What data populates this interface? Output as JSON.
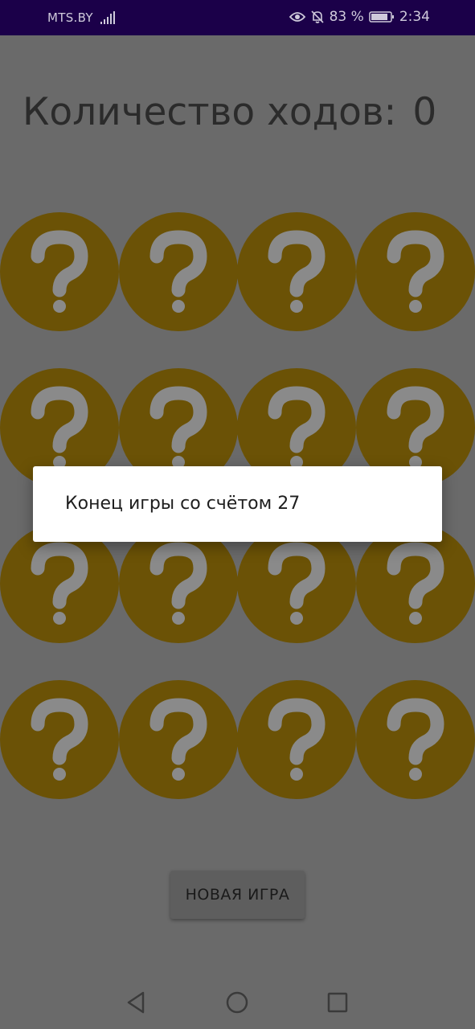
{
  "status_bar": {
    "carrier": "MTS.BY",
    "battery_percent": "83 %",
    "time": "2:34",
    "icons": [
      "signal-icon",
      "eye-icon",
      "notifications-off-icon",
      "battery-icon"
    ]
  },
  "game": {
    "moves_label": "Количество ходов:",
    "moves_count": "0",
    "cards": [
      {
        "symbol": "?"
      },
      {
        "symbol": "?"
      },
      {
        "symbol": "?"
      },
      {
        "symbol": "?"
      },
      {
        "symbol": "?"
      },
      {
        "symbol": "?"
      },
      {
        "symbol": "?"
      },
      {
        "symbol": "?"
      },
      {
        "symbol": "?"
      },
      {
        "symbol": "?"
      },
      {
        "symbol": "?"
      },
      {
        "symbol": "?"
      },
      {
        "symbol": "?"
      },
      {
        "symbol": "?"
      },
      {
        "symbol": "?"
      },
      {
        "symbol": "?"
      }
    ],
    "new_game_label": "НОВАЯ ИГРА"
  },
  "dialog": {
    "message": "Конец игры со счётом 27"
  },
  "nav_bar": {
    "icons": [
      "back-icon",
      "home-icon",
      "recents-icon"
    ]
  },
  "colors": {
    "status_bar": "#1b0049",
    "dimmed_background": "#6a6a6a",
    "card_face": "#6b5206",
    "question_mark": "#8a8a8a"
  }
}
